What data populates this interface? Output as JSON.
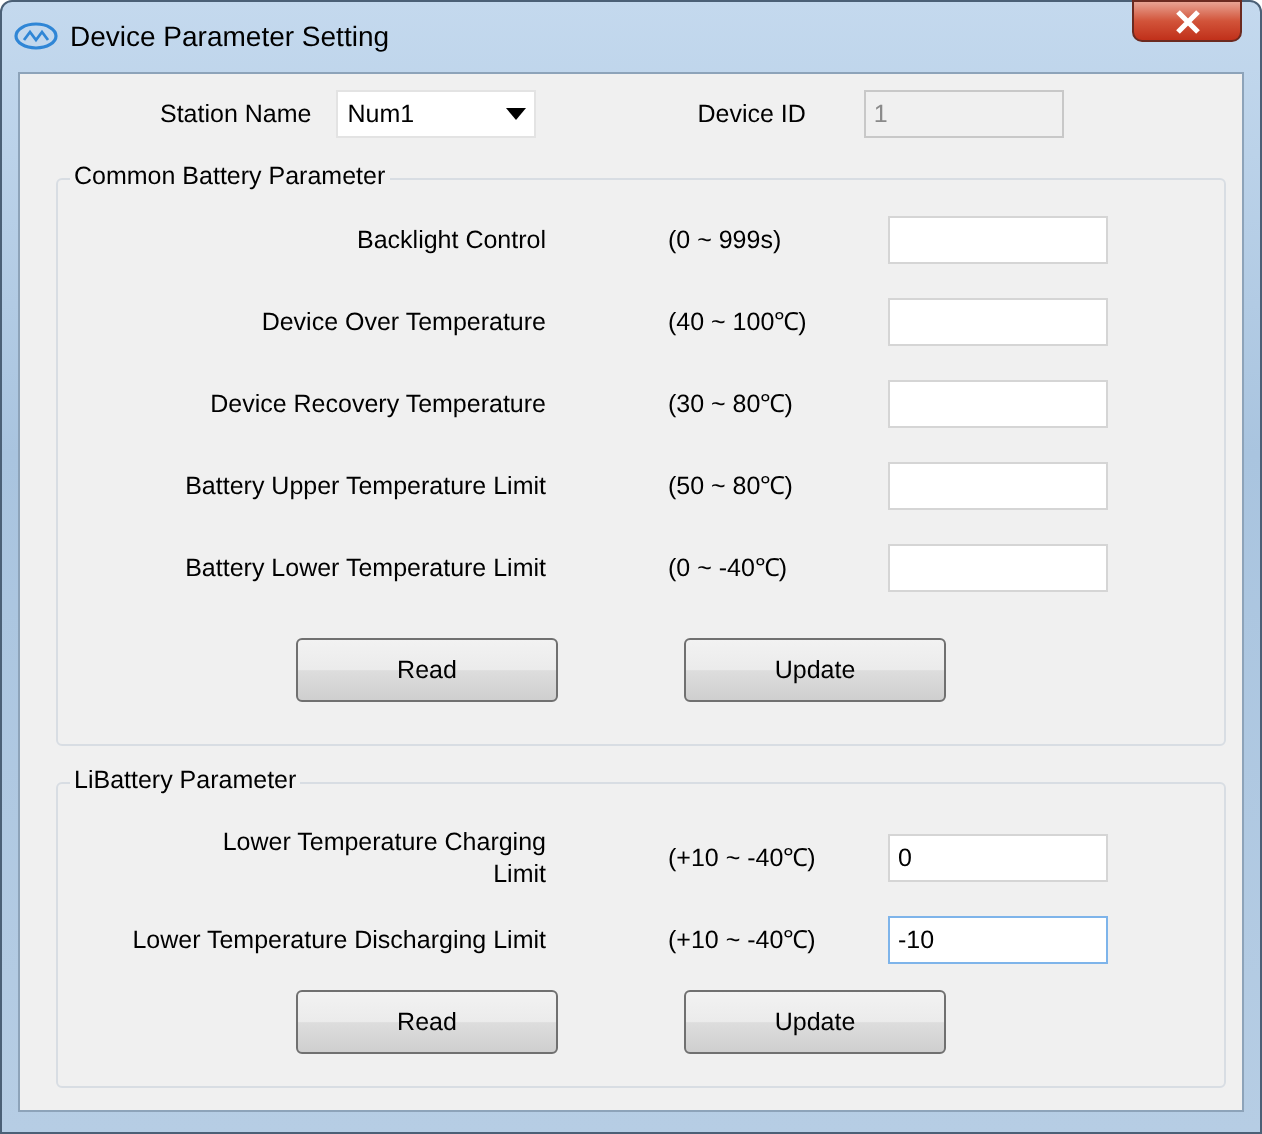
{
  "window": {
    "title": "Device Parameter Setting"
  },
  "station": {
    "label": "Station Name",
    "value": "Num1"
  },
  "device_id": {
    "label": "Device ID",
    "value": "1",
    "disabled": true
  },
  "groups": [
    {
      "title": "Common Battery Parameter",
      "rows": [
        {
          "label": "Backlight Control",
          "range": "(0 ~ 999s)",
          "focused": false
        },
        {
          "label": "Device Over Temperature",
          "range": "(40 ~ 100℃)",
          "focused": false
        },
        {
          "label": "Device Recovery Temperature",
          "range": "(30 ~ 80℃)",
          "focused": false
        },
        {
          "label": "Battery Upper Temperature Limit",
          "range": "(50 ~ 80℃)",
          "focused": false
        },
        {
          "label": "Battery Lower Temperature Limit",
          "range": "(0 ~ -40℃)",
          "focused": false
        }
      ],
      "buttons": [
        "Read",
        "Update"
      ]
    },
    {
      "title": "LiBattery Parameter",
      "rows": [
        {
          "label": "Lower Temperature Charging\nLimit",
          "range": "(+10 ~ -40℃)",
          "value": "0",
          "focused": false
        },
        {
          "label": "Lower Temperature Discharging Limit",
          "range": "(+10 ~ -40℃)",
          "value": "-10",
          "focused": true
        }
      ],
      "buttons": [
        "Read",
        "Update"
      ]
    }
  ]
}
